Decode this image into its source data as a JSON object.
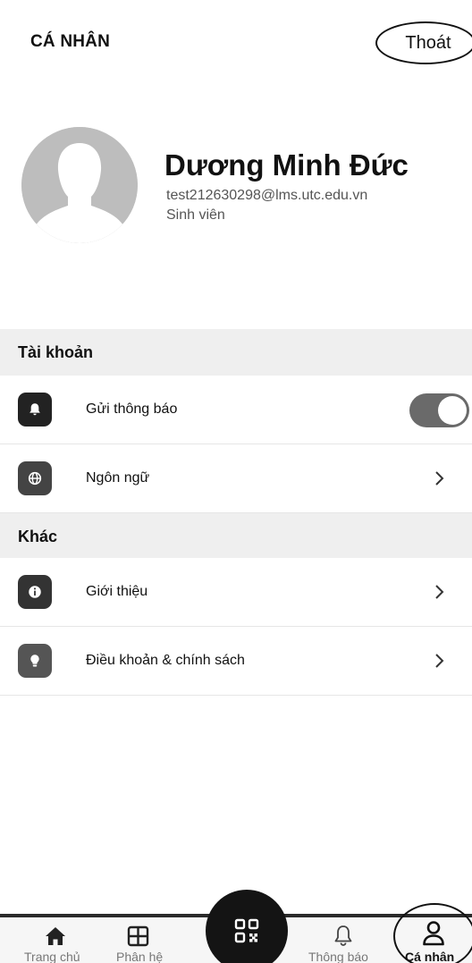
{
  "header": {
    "title": "CÁ NHÂN",
    "logout_label": "Thoát"
  },
  "profile": {
    "name": "Dương Minh Đức",
    "email": "test212630298@lms.utc.edu.vn",
    "role": "Sinh viên"
  },
  "sections": {
    "account": {
      "title": "Tài khoản",
      "items": [
        {
          "label": "Gửi thông báo",
          "icon": "bell-icon",
          "toggle_on": true
        },
        {
          "label": "Ngôn ngữ",
          "icon": "globe-icon"
        }
      ]
    },
    "other": {
      "title": "Khác",
      "items": [
        {
          "label": "Giới thiệu",
          "icon": "info-icon"
        },
        {
          "label": "Điều khoản & chính sách",
          "icon": "lightbulb-icon"
        }
      ]
    }
  },
  "tabbar": {
    "items": [
      {
        "label": "Trang chủ",
        "icon": "home-icon"
      },
      {
        "label": "Phân hệ",
        "icon": "grid-icon"
      },
      {
        "label": "",
        "icon": "qr-scan-icon"
      },
      {
        "label": "Thông báo",
        "icon": "bell-icon"
      },
      {
        "label": "Cá nhân",
        "icon": "person-icon",
        "active": true
      }
    ]
  }
}
